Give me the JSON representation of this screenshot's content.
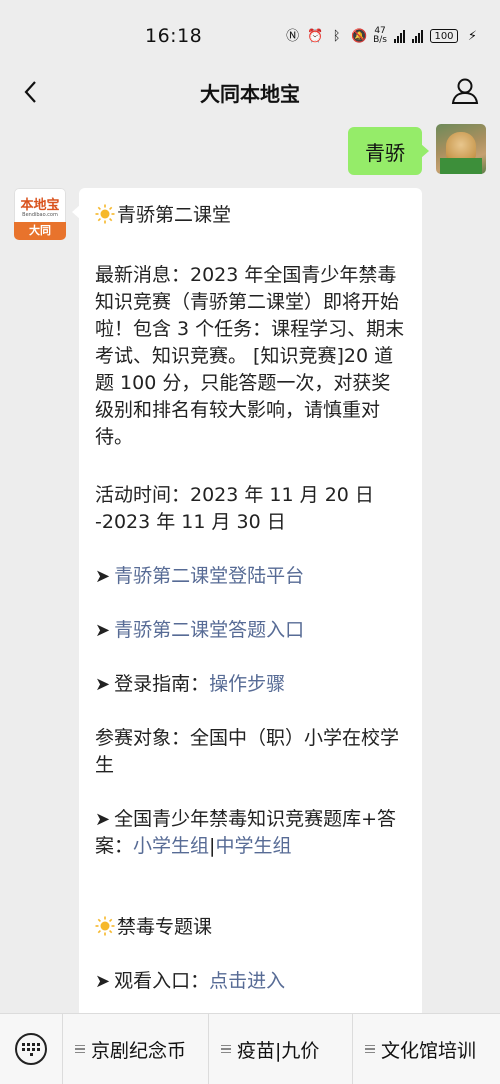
{
  "status": {
    "time": "16:18",
    "net_speed_value": "47",
    "net_speed_unit": "B/s",
    "battery": "100"
  },
  "nav": {
    "title": "大同本地宝"
  },
  "outgoing_message": "青骄",
  "bot_avatar": {
    "logo_text": "本地宝",
    "logo_url": "Bendibao.com",
    "city": "大同"
  },
  "reply": {
    "heading": "青骄第二课堂",
    "news": "最新消息：2023 年全国青少年禁毒知识竞赛（青骄第二课堂）即将开始啦！包含 3 个任务：课程学习、期末考试、知识竞赛。 [知识竞赛]20 道题 100 分，只能答题一次，对获奖级别和排名有较大影响，请慎重对待。",
    "time_line1": "活动时间：2023 年 11 月 20 日",
    "time_line2": "-2023 年 11 月 30 日",
    "link_platform": "青骄第二课堂登陆平台",
    "link_answer": "青骄第二课堂答题入口",
    "guide_label": "登录指南：",
    "guide_link": "操作步骤",
    "audience": "参赛对象：全国中（职）小学在校学生",
    "bank_text": "全国青少年禁毒知识竞赛题库+答案：",
    "bank_link_primary": "小学生组",
    "bank_sep": "|",
    "bank_link_middle": "中学生组",
    "course_heading": "禁毒专题课",
    "watch_label": "观看入口：",
    "watch_link": "点击进入"
  },
  "bottom_menu": [
    "京剧纪念币",
    "疫苗|九价",
    "文化馆培训"
  ]
}
